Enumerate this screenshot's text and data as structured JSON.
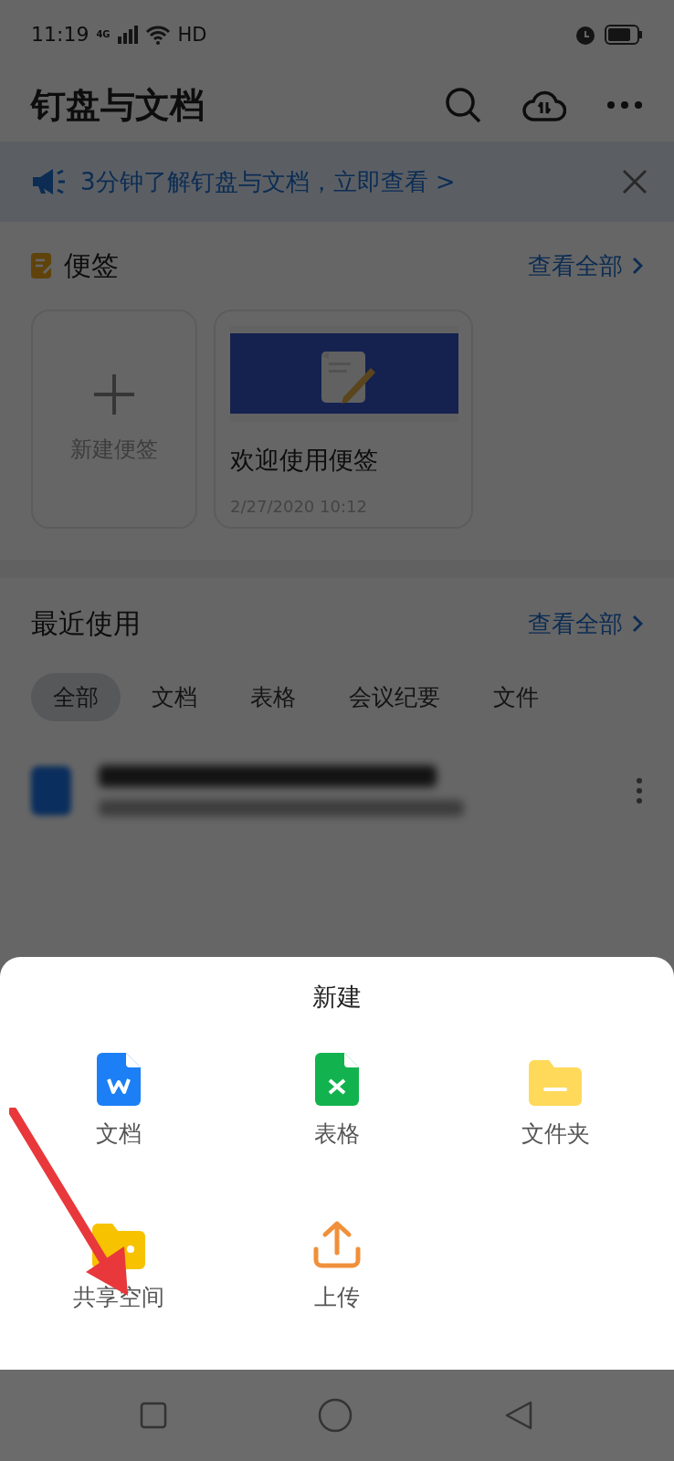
{
  "status_bar": {
    "time": "11:19",
    "network": "4G",
    "hd": "HD"
  },
  "header": {
    "title": "钉盘与文档"
  },
  "banner": {
    "text": "3分钟了解钉盘与文档，立即查看 >"
  },
  "notes": {
    "title": "便签",
    "view_all": "查看全部",
    "new_label": "新建便签",
    "cards": [
      {
        "title": "欢迎使用便签",
        "date": "2/27/2020 10:12"
      }
    ]
  },
  "recent": {
    "title": "最近使用",
    "view_all": "查看全部",
    "tabs": [
      {
        "label": "全部",
        "selected": true
      },
      {
        "label": "文档",
        "selected": false
      },
      {
        "label": "表格",
        "selected": false
      },
      {
        "label": "会议纪要",
        "selected": false
      },
      {
        "label": "文件",
        "selected": false
      }
    ]
  },
  "sheet": {
    "title": "新建",
    "items": [
      {
        "label": "文档",
        "kind": "doc"
      },
      {
        "label": "表格",
        "kind": "sheet"
      },
      {
        "label": "文件夹",
        "kind": "folder"
      },
      {
        "label": "共享空间",
        "kind": "shared"
      },
      {
        "label": "上传",
        "kind": "upload"
      }
    ]
  }
}
